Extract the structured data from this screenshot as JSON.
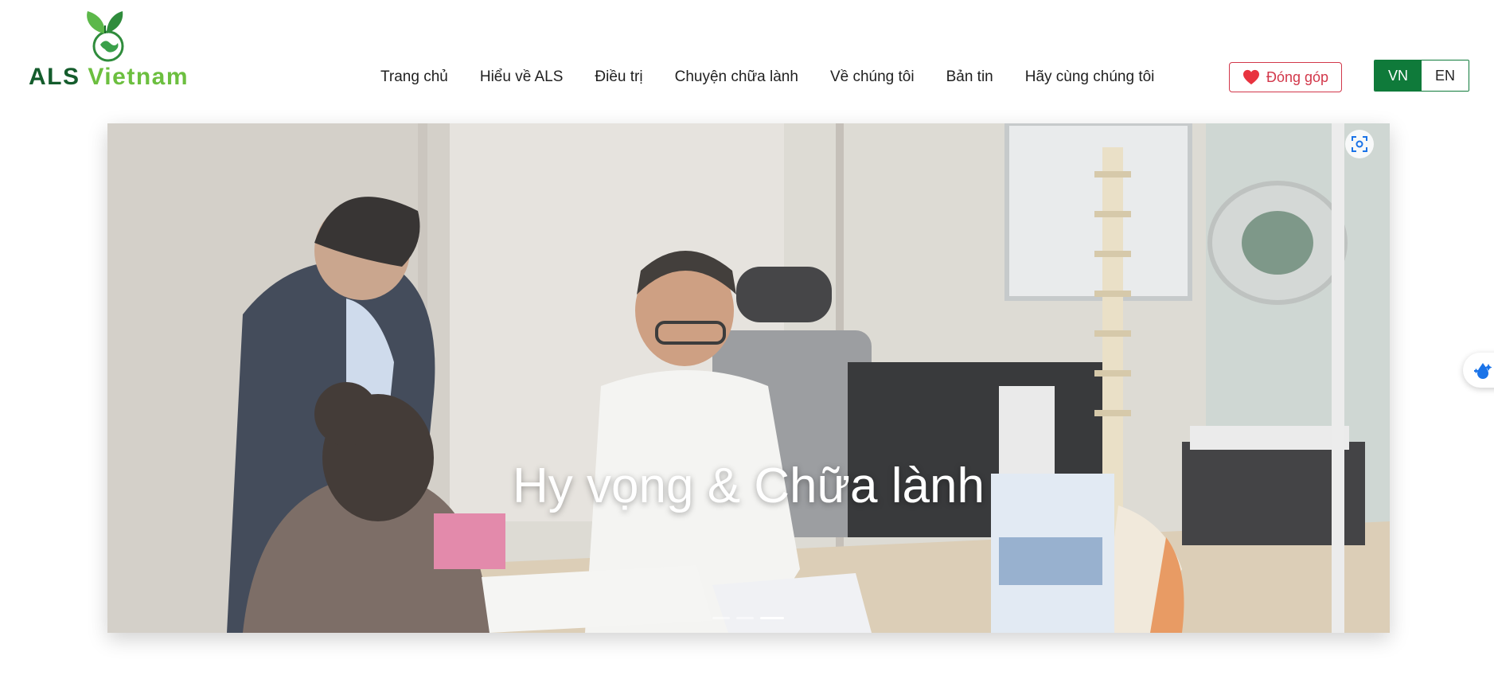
{
  "logo": {
    "part1": "ALS",
    "part2": "Vietnam"
  },
  "nav": {
    "items": [
      "Trang chủ",
      "Hiểu về ALS",
      "Điều trị",
      "Chuyện chữa lành",
      "Về chúng tôi",
      "Bản tin",
      "Hãy cùng chúng tôi"
    ]
  },
  "donate": {
    "label": "Đóng góp",
    "icon": "heart-icon",
    "color": "#d2374a"
  },
  "language": {
    "active": "VN",
    "inactive": "EN",
    "accent": "#0f7a3a"
  },
  "hero": {
    "caption": "Hy vọng & Chữa lành",
    "slides_count": 3,
    "active_slide": 3
  },
  "icons": {
    "scan": "scan-icon",
    "widget": "water-drop-icon"
  }
}
